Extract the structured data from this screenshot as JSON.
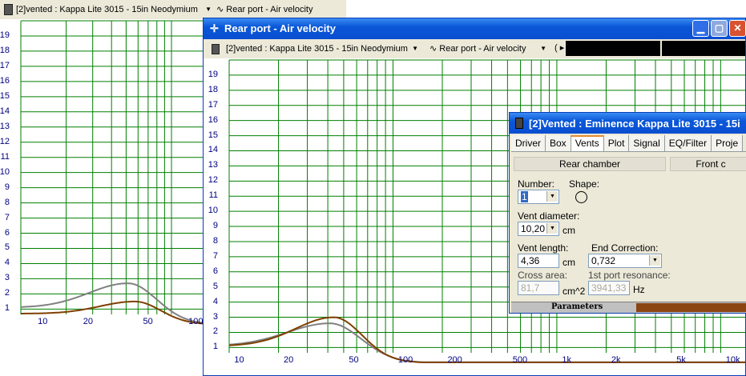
{
  "back_window": {
    "driver_select": "[2]vented : Kappa Lite 3015 - 15in Neodymium",
    "plot_select": "Rear port - Air velocity",
    "y_ticks": [
      "19",
      "18",
      "17",
      "16",
      "15",
      "14",
      "13",
      "12",
      "11",
      "10",
      "9",
      "8",
      "7",
      "6",
      "5",
      "4",
      "3",
      "2",
      "1"
    ],
    "x_ticks": [
      "10",
      "20",
      "50",
      "100"
    ],
    "colors": {
      "grid": "#007f00",
      "curve_gray": "#808080",
      "curve_brown": "#7f3f00"
    }
  },
  "front_window": {
    "title": "Rear port - Air velocity",
    "driver_select": "[2]vented : Kappa Lite 3015 - 15in Neodymium",
    "plot_select": "Rear port - Air velocity",
    "y_ticks": [
      "19",
      "18",
      "17",
      "16",
      "15",
      "14",
      "13",
      "12",
      "11",
      "10",
      "9",
      "8",
      "7",
      "6",
      "5",
      "4",
      "3",
      "2",
      "1"
    ],
    "x_ticks": [
      "10",
      "20",
      "50",
      "100",
      "200",
      "500",
      "1k",
      "2k",
      "5k",
      "10k"
    ]
  },
  "params_window": {
    "title": "[2]Vented : Eminence Kappa Lite 3015 - 15i",
    "tabs": [
      "Driver",
      "Box",
      "Vents",
      "Plot",
      "Signal",
      "EQ/Filter",
      "Proje"
    ],
    "active_tab": "Vents",
    "rear_chamber_label": "Rear chamber",
    "front_chamber_label": "Front c",
    "number_label": "Number:",
    "number_value": "1",
    "shape_label": "Shape:",
    "vent_diameter_label": "Vent diameter:",
    "vent_diameter_value": "10,20",
    "vent_diameter_unit": "cm",
    "vent_length_label": "Vent length:",
    "vent_length_value": "4,36",
    "vent_length_unit": "cm",
    "end_correction_label": "End Correction:",
    "end_correction_value": "0,732",
    "cross_area_label": "Cross area:",
    "cross_area_value": "81,7",
    "cross_area_unit": "cm^2",
    "port_resonance_label": "1st port resonance:",
    "port_resonance_value": "3941,33",
    "port_resonance_unit": "Hz",
    "footer_label": "Parameters"
  }
}
